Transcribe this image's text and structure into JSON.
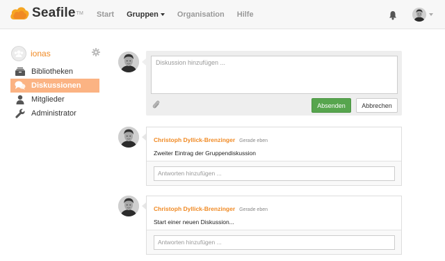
{
  "app": {
    "logo_text": "Seafile",
    "logo_tm": "TM"
  },
  "nav": {
    "items": [
      {
        "label": "Start",
        "active": false
      },
      {
        "label": "Gruppen",
        "active": true,
        "dropdown": true
      },
      {
        "label": "Organisation",
        "active": false
      },
      {
        "label": "Hilfe",
        "active": false
      }
    ],
    "icons": {
      "notifications": "bell-icon",
      "user_menu_caret": "chevron-down-icon"
    }
  },
  "sidebar": {
    "group_name": "ionas",
    "items": [
      {
        "label": "Bibliotheken",
        "icon": "library-icon",
        "active": false
      },
      {
        "label": "Diskussionen",
        "icon": "discussion-icon",
        "active": true
      },
      {
        "label": "Mitglieder",
        "icon": "person-icon",
        "active": false
      },
      {
        "label": "Administrator",
        "icon": "wrench-icon",
        "active": false
      }
    ]
  },
  "composer": {
    "placeholder": "Diskussion hinzufügen ...",
    "send_label": "Absenden",
    "cancel_label": "Abbrechen"
  },
  "threads": [
    {
      "author": "Christoph Dyllick-Brenzinger",
      "time": "Gerade eben",
      "message": "Zweiter Eintrag der Gruppendiskussion",
      "reply_placeholder": "Antworten hinzufügen ..."
    },
    {
      "author": "Christoph Dyllick-Brenzinger",
      "time": "Gerade eben",
      "message": "Start einer neuen Diskussion...",
      "reply_placeholder": "Antworten hinzufügen ..."
    }
  ],
  "colors": {
    "accent": "#f08a24",
    "active_sidebar": "#fbb383",
    "send_button": "#57a54e"
  }
}
